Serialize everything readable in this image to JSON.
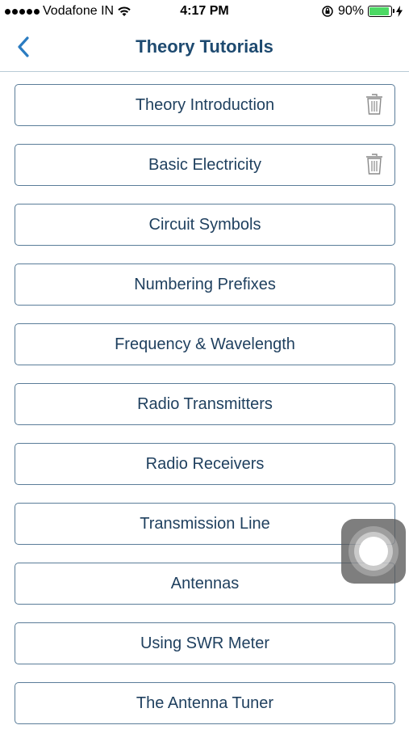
{
  "status_bar": {
    "carrier": "Vodafone IN",
    "time": "4:17 PM",
    "battery_percent": "90%",
    "battery_level": 0.9,
    "icons": [
      "signal-dots-icon",
      "wifi-icon",
      "orientation-lock-icon",
      "battery-icon",
      "charging-bolt-icon"
    ]
  },
  "nav": {
    "title": "Theory Tutorials",
    "back_icon": "chevron-left-icon"
  },
  "tutorials": [
    {
      "label": "Theory Introduction",
      "deletable": true
    },
    {
      "label": "Basic Electricity",
      "deletable": true
    },
    {
      "label": "Circuit Symbols",
      "deletable": false
    },
    {
      "label": "Numbering Prefixes",
      "deletable": false
    },
    {
      "label": "Frequency & Wavelength",
      "deletable": false
    },
    {
      "label": "Radio Transmitters",
      "deletable": false
    },
    {
      "label": "Radio Receivers",
      "deletable": false
    },
    {
      "label": "Transmission Line",
      "deletable": false
    },
    {
      "label": "Antennas",
      "deletable": false
    },
    {
      "label": "Using SWR Meter",
      "deletable": false
    },
    {
      "label": "The Antenna Tuner",
      "deletable": false
    }
  ],
  "colors": {
    "accent": "#2b7cc1",
    "title": "#1e4a70",
    "item_text": "#1e3f5e",
    "item_border": "#5b7d99",
    "battery": "#4cd964"
  }
}
